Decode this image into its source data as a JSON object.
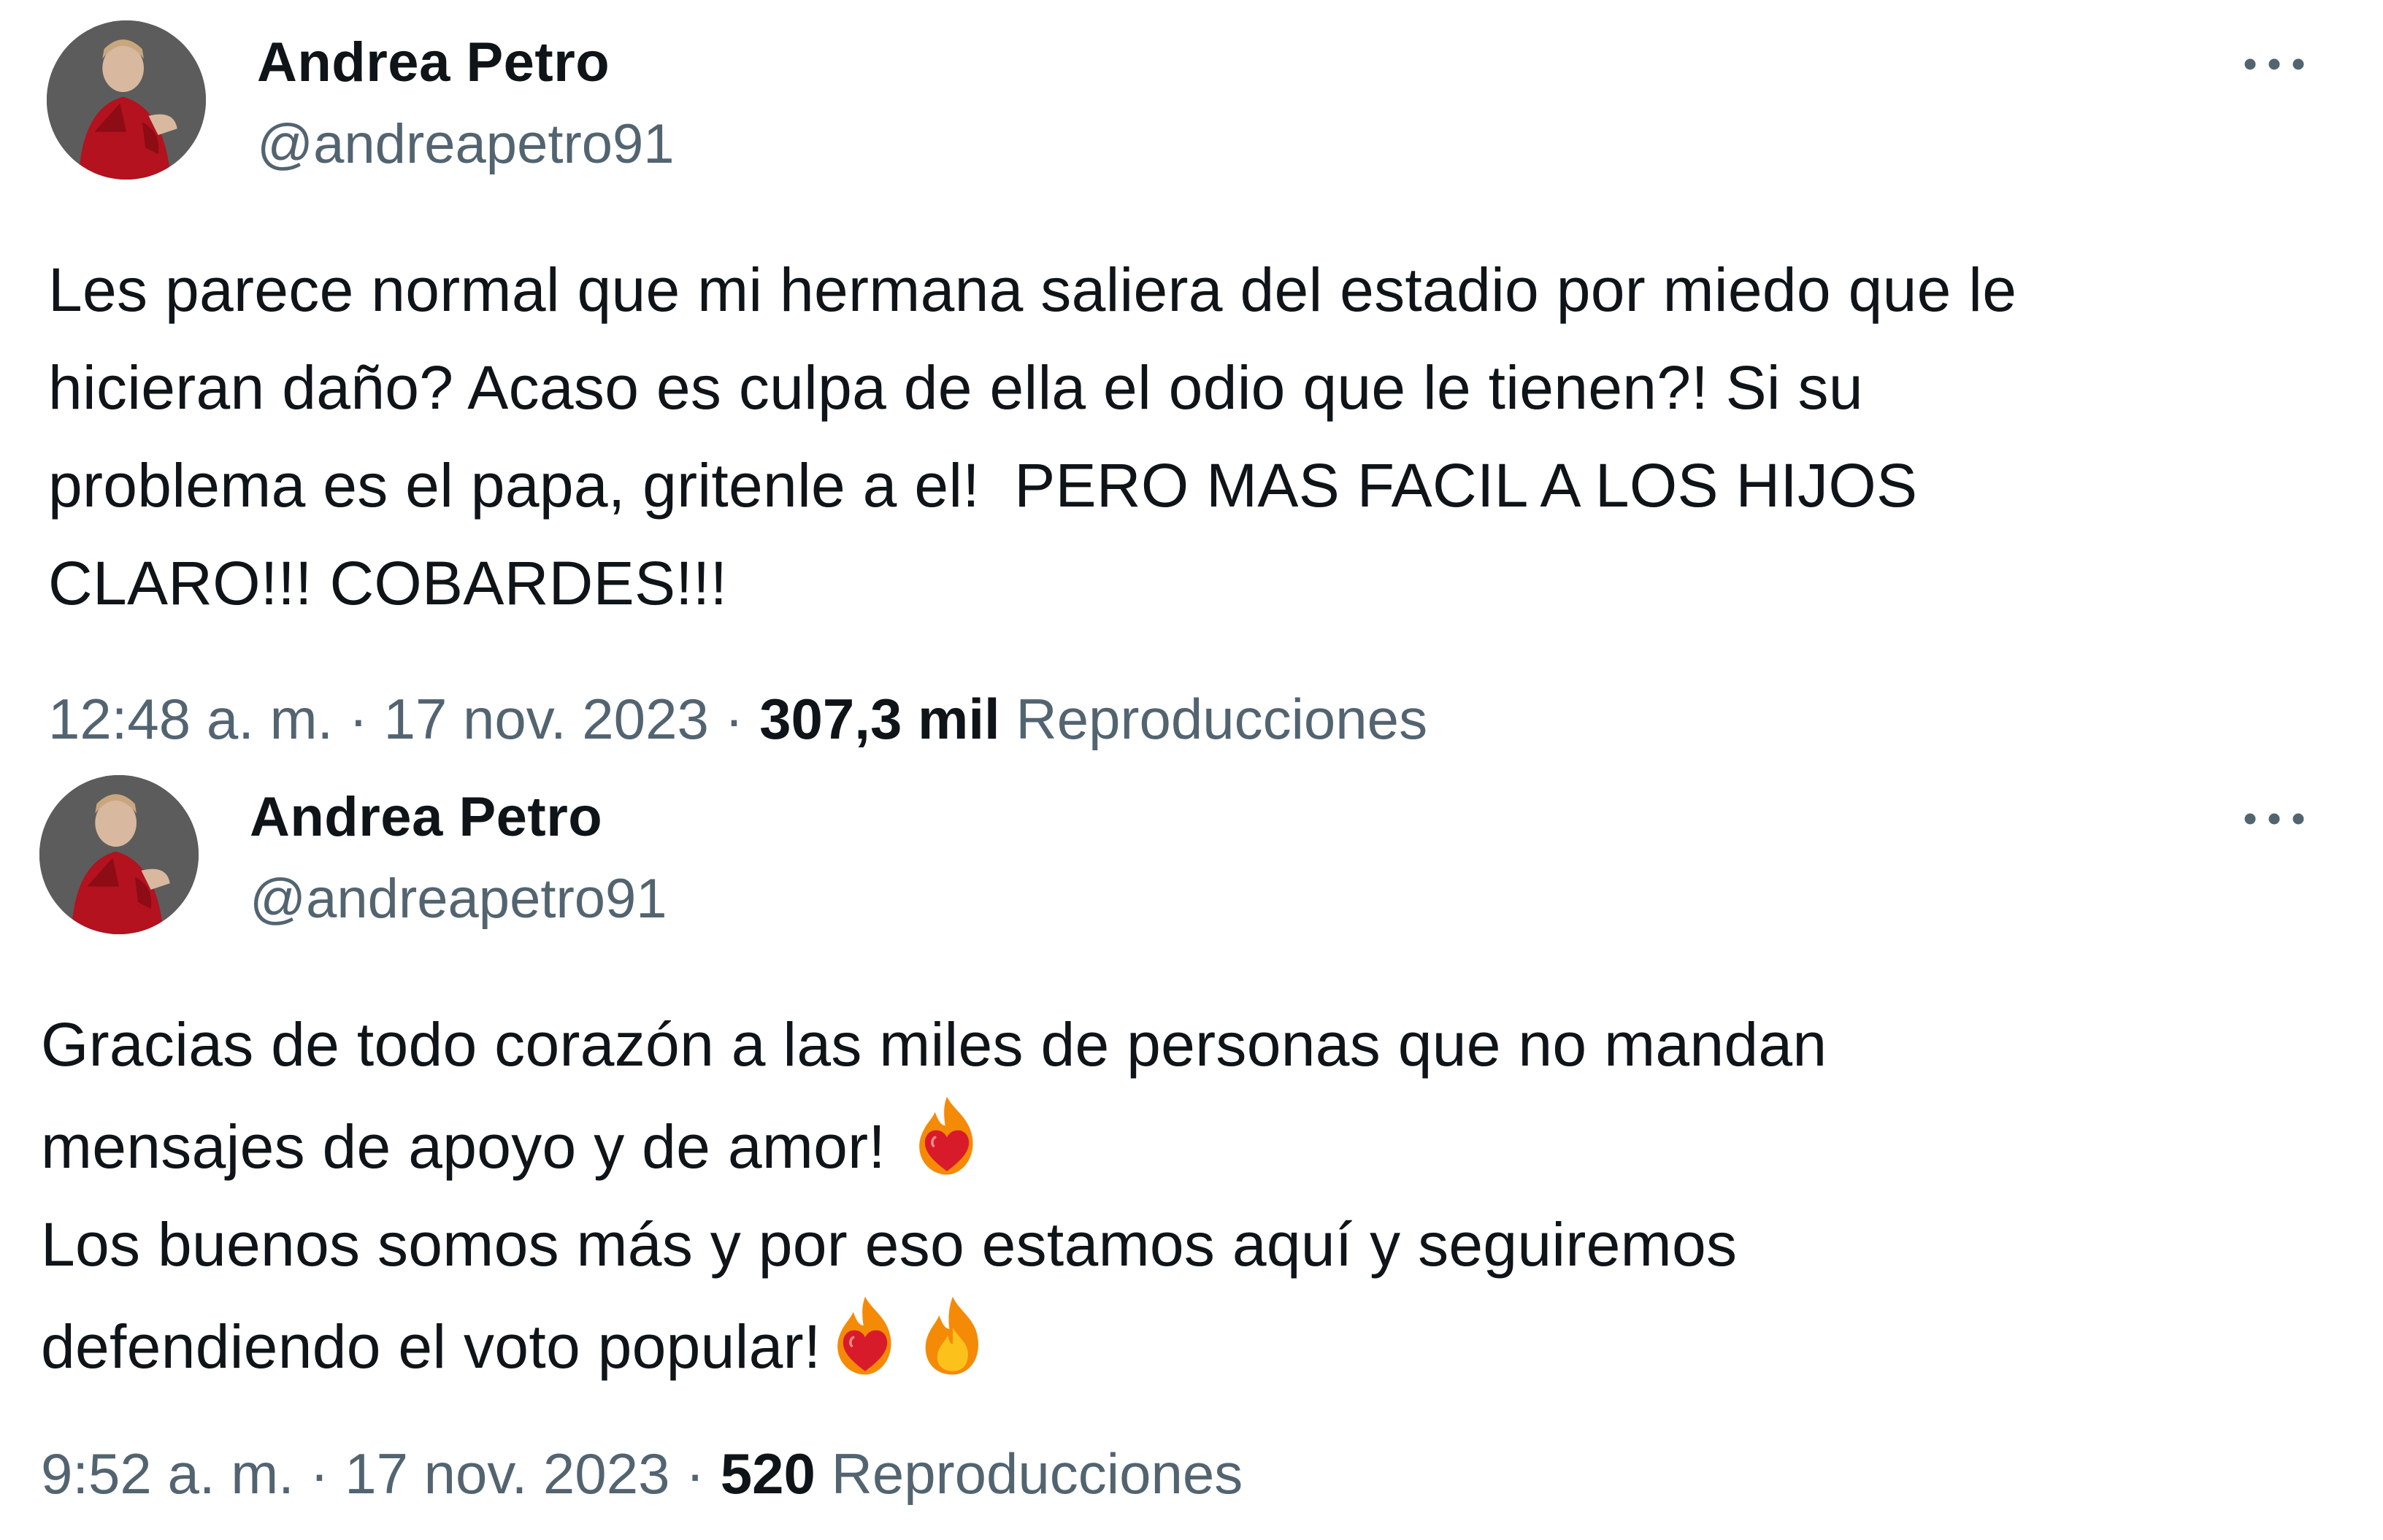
{
  "tweets": [
    {
      "author": {
        "display_name": "Andrea Petro",
        "handle": "@andreapetro91",
        "avatar_icon": "avatar-photo"
      },
      "more_icon": "more-options-icon",
      "text_lines": [
        "Les parece normal que mi hermana saliera del estadio por miedo que le",
        "hicieran daño? Acaso es culpa de ella el odio que le tienen?! Si su",
        "problema es el papa, gritenle a el!  PERO MAS FACIL A LOS HIJOS",
        "CLARO!!! COBARDES!!!"
      ],
      "time": "12:48 a. m.",
      "separator": "·",
      "date": "17 nov. 2023",
      "views_count": "307,3 mil",
      "views_label": "Reproducciones"
    },
    {
      "author": {
        "display_name": "Andrea Petro",
        "handle": "@andreapetro91",
        "avatar_icon": "avatar-photo"
      },
      "more_icon": "more-options-icon",
      "text_lines": [
        "Gracias de todo corazón a las miles de personas que no mandan",
        "mensajes de apoyo y de amor!",
        "Los buenos somos más y por eso estamos aquí y seguiremos",
        "defendiendo el voto popular!"
      ],
      "emojis": [
        "heart-on-fire-icon",
        "heart-on-fire-icon",
        "fire-icon"
      ],
      "time": "9:52 a. m.",
      "separator": "·",
      "date": "17 nov. 2023",
      "views_count": "520",
      "views_label": "Reproducciones"
    }
  ],
  "colors": {
    "text_primary": "#0f1419",
    "text_secondary": "#536471",
    "background": "#ffffff"
  }
}
